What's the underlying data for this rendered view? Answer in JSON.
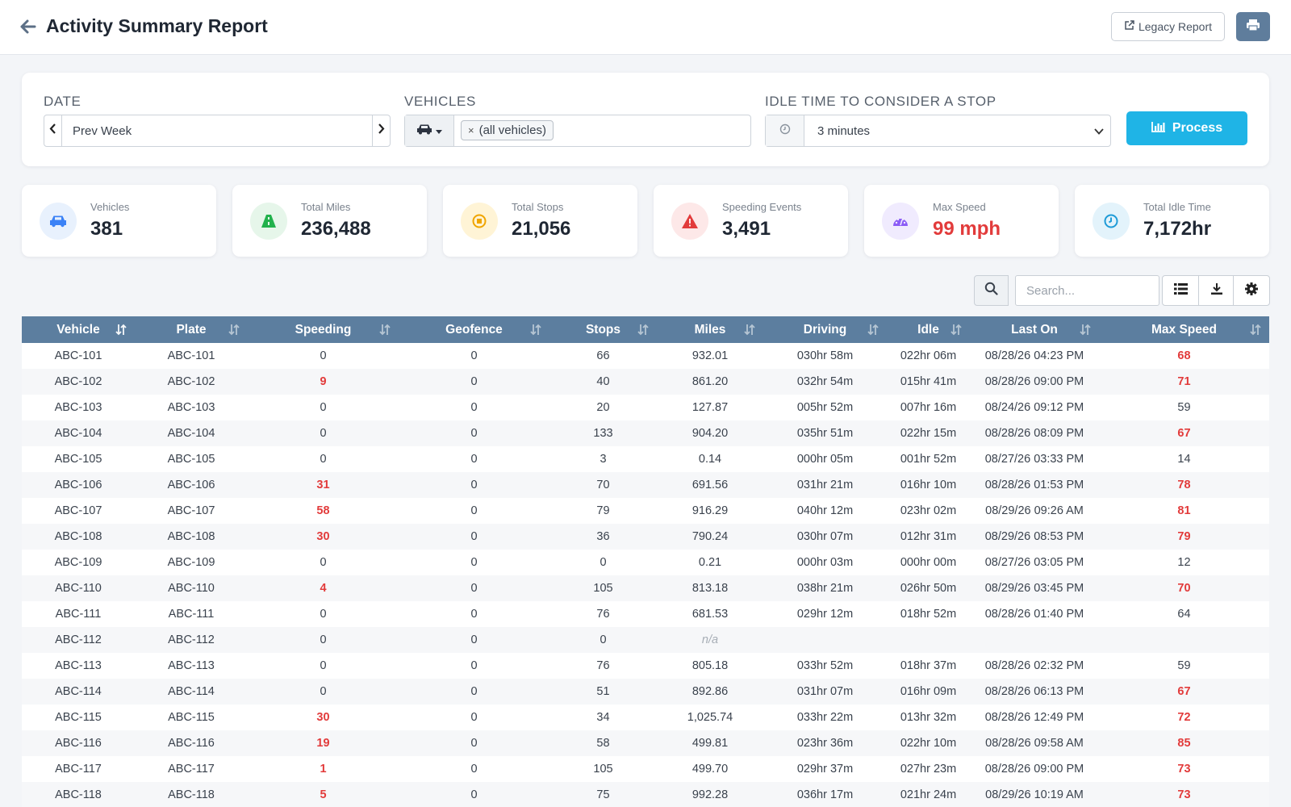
{
  "header": {
    "title": "Activity Summary Report",
    "legacy_label": "Legacy Report"
  },
  "filters": {
    "date_label": "DATE",
    "date_value": "Prev Week",
    "vehicles_label": "VEHICLES",
    "vehicles_chip": "(all vehicles)",
    "chip_remove": "×",
    "idle_label": "IDLE TIME TO CONSIDER A STOP",
    "idle_value": "3 minutes",
    "process_label": "Process"
  },
  "stats": [
    {
      "label": "Vehicles",
      "value": "381",
      "icon": "car-icon",
      "color": "#3b82f6",
      "bg": "#e8f1fd"
    },
    {
      "label": "Total Miles",
      "value": "236,488",
      "icon": "road-icon",
      "color": "#22b14c",
      "bg": "#e6f6ea"
    },
    {
      "label": "Total Stops",
      "value": "21,056",
      "icon": "stop-icon",
      "color": "#f0a500",
      "bg": "#fff4d6"
    },
    {
      "label": "Speeding Events",
      "value": "3,491",
      "icon": "warning-icon",
      "color": "#e23b3b",
      "bg": "#fde8e8"
    },
    {
      "label": "Max Speed",
      "value": "99 mph",
      "icon": "speedometer-icon",
      "color": "#8b5cf6",
      "bg": "#f0ebfe",
      "value_color": "#e23b3b"
    },
    {
      "label": "Total Idle Time",
      "value": "7,172hr",
      "icon": "clock-icon",
      "color": "#1e9bd7",
      "bg": "#e3f3fb"
    }
  ],
  "toolbar": {
    "search_placeholder": "Search..."
  },
  "table": {
    "columns": [
      "Vehicle",
      "Plate",
      "Speeding",
      "Geofence",
      "Stops",
      "Miles",
      "Driving",
      "Idle",
      "Last On",
      "Max Speed"
    ],
    "rows": [
      [
        "ABC-101",
        "ABC-101",
        "0",
        "0",
        "66",
        "932.01",
        "030hr 58m",
        "022hr 06m",
        "08/28/26 04:23 PM",
        "68"
      ],
      [
        "ABC-102",
        "ABC-102",
        "9",
        "0",
        "40",
        "861.20",
        "032hr 54m",
        "015hr 41m",
        "08/28/26 09:00 PM",
        "71"
      ],
      [
        "ABC-103",
        "ABC-103",
        "0",
        "0",
        "20",
        "127.87",
        "005hr 52m",
        "007hr 16m",
        "08/24/26 09:12 PM",
        "59"
      ],
      [
        "ABC-104",
        "ABC-104",
        "0",
        "0",
        "133",
        "904.20",
        "035hr 51m",
        "022hr 15m",
        "08/28/26 08:09 PM",
        "67"
      ],
      [
        "ABC-105",
        "ABC-105",
        "0",
        "0",
        "3",
        "0.14",
        "000hr 05m",
        "001hr 52m",
        "08/27/26 03:33 PM",
        "14"
      ],
      [
        "ABC-106",
        "ABC-106",
        "31",
        "0",
        "70",
        "691.56",
        "031hr 21m",
        "016hr 10m",
        "08/28/26 01:53 PM",
        "78"
      ],
      [
        "ABC-107",
        "ABC-107",
        "58",
        "0",
        "79",
        "916.29",
        "040hr 12m",
        "023hr 02m",
        "08/29/26 09:26 AM",
        "81"
      ],
      [
        "ABC-108",
        "ABC-108",
        "30",
        "0",
        "36",
        "790.24",
        "030hr 07m",
        "012hr 31m",
        "08/29/26 08:53 PM",
        "79"
      ],
      [
        "ABC-109",
        "ABC-109",
        "0",
        "0",
        "0",
        "0.21",
        "000hr 03m",
        "000hr 00m",
        "08/27/26 03:05 PM",
        "12"
      ],
      [
        "ABC-110",
        "ABC-110",
        "4",
        "0",
        "105",
        "813.18",
        "038hr 21m",
        "026hr 50m",
        "08/29/26 03:45 PM",
        "70"
      ],
      [
        "ABC-111",
        "ABC-111",
        "0",
        "0",
        "76",
        "681.53",
        "029hr 12m",
        "018hr 52m",
        "08/28/26 01:40 PM",
        "64"
      ],
      [
        "ABC-112",
        "ABC-112",
        "0",
        "0",
        "0",
        "n/a",
        "",
        "",
        "",
        ""
      ],
      [
        "ABC-113",
        "ABC-113",
        "0",
        "0",
        "76",
        "805.18",
        "033hr 52m",
        "018hr 37m",
        "08/28/26 02:32 PM",
        "59"
      ],
      [
        "ABC-114",
        "ABC-114",
        "0",
        "0",
        "51",
        "892.86",
        "031hr 07m",
        "016hr 09m",
        "08/28/26 06:13 PM",
        "67"
      ],
      [
        "ABC-115",
        "ABC-115",
        "30",
        "0",
        "34",
        "1,025.74",
        "033hr 22m",
        "013hr 32m",
        "08/28/26 12:49 PM",
        "72"
      ],
      [
        "ABC-116",
        "ABC-116",
        "19",
        "0",
        "58",
        "499.81",
        "023hr 36m",
        "022hr 10m",
        "08/28/26 09:58 AM",
        "85"
      ],
      [
        "ABC-117",
        "ABC-117",
        "1",
        "0",
        "105",
        "499.70",
        "029hr 37m",
        "027hr 23m",
        "08/28/26 09:00 PM",
        "73"
      ],
      [
        "ABC-118",
        "ABC-118",
        "5",
        "0",
        "75",
        "992.28",
        "036hr 17m",
        "021hr 24m",
        "08/29/26 10:19 AM",
        "73"
      ]
    ]
  },
  "colors": {
    "header_row": "#5c7e9f",
    "accent": "#1fb4e6",
    "alert": "#e23b3b"
  }
}
